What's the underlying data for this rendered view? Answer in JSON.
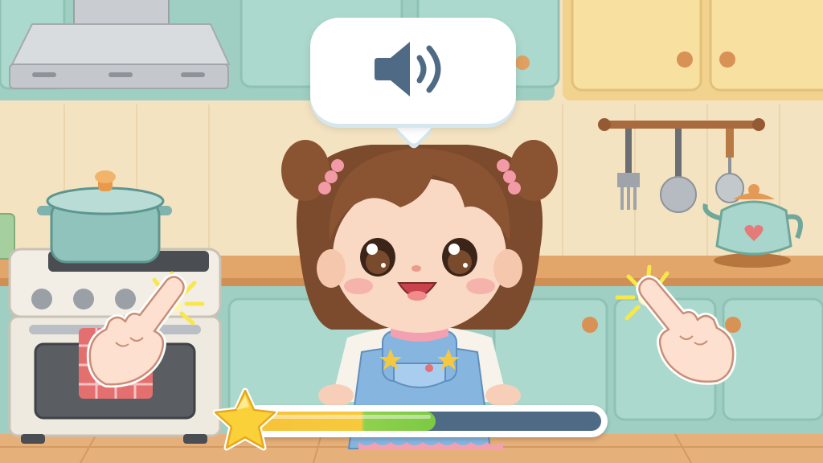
{
  "game": {
    "scene": "kitchen",
    "audio_button": {
      "icon": "speaker-icon",
      "state": "sound-on"
    },
    "progress": {
      "value": 0.53,
      "icon": "star-icon"
    },
    "hints": [
      {
        "icon": "tap-hand-icon",
        "side": "left"
      },
      {
        "icon": "tap-hand-icon",
        "side": "right"
      }
    ],
    "character": {
      "icon": "girl-character"
    }
  },
  "colors": {
    "bubble": "#ffffff",
    "speaker": "#4f6a84",
    "progress_track": "#4f6a84",
    "progress_yellow": "#f6c33b",
    "progress_green": "#7cc943",
    "star": "#fbd13a",
    "cabinets": "#a9d8cc",
    "upper_cabinets": "#f8e1a0",
    "counter": "#e3a66a"
  }
}
